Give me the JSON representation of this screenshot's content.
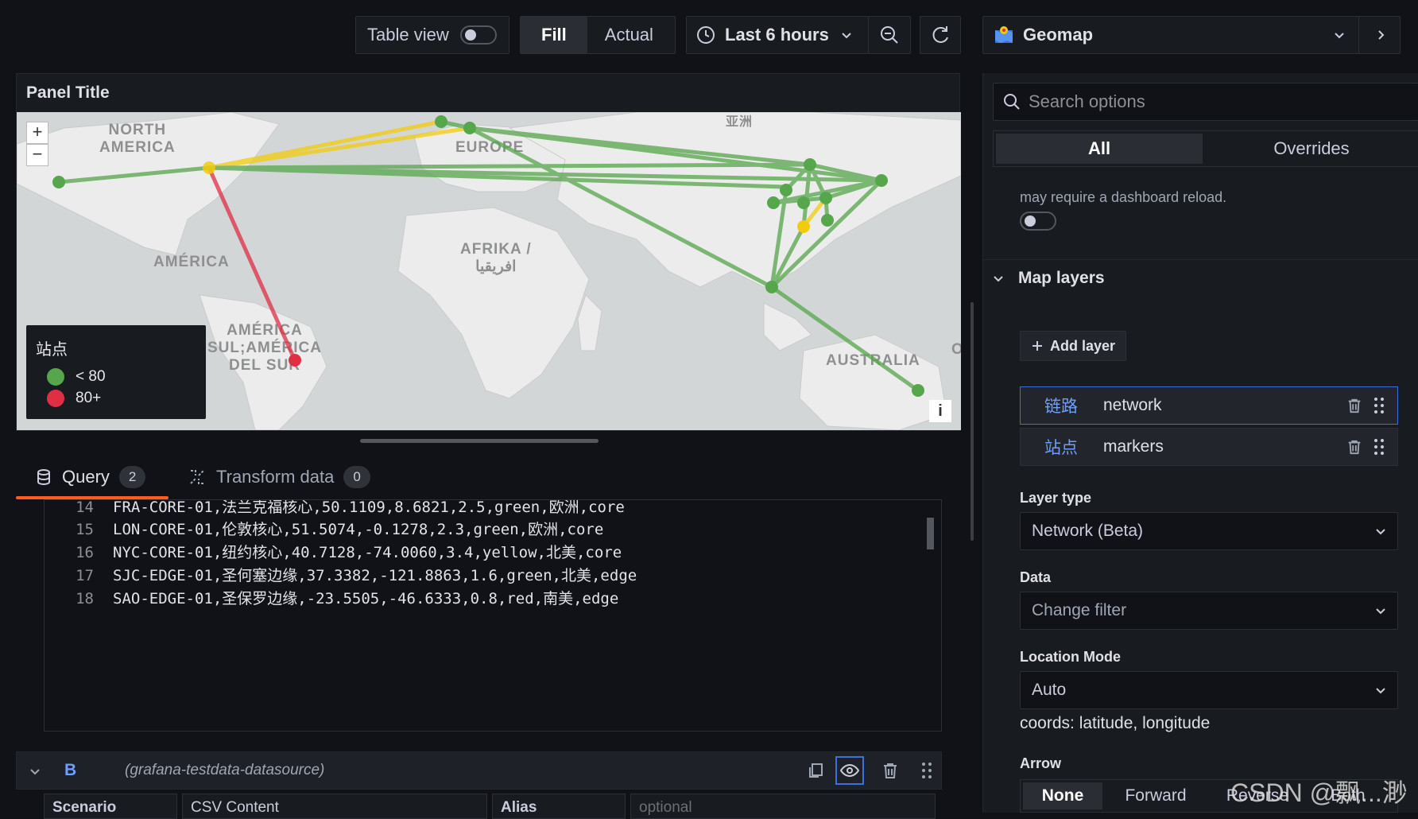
{
  "toolbar": {
    "table_view_label": "Table view",
    "fill_label": "Fill",
    "actual_label": "Actual",
    "time_range": "Last 6 hours",
    "visualization": "Geomap"
  },
  "panel": {
    "title": "Panel Title",
    "map_labels": {
      "north_america": "NORTH\nAMERICA",
      "europe": "EUROPE",
      "asia": "亚洲",
      "america": "AMÉRICA",
      "africa": "AFRIKA /\nافريقيا",
      "south_america": "AMÉRICA\nSUL;AMÉRICA\nDEL SUR",
      "australia": "AUSTRALIA",
      "edge_char": "O"
    },
    "legend": {
      "title": "站点",
      "items": [
        {
          "label": "< 80",
          "color": "#56a64b"
        },
        {
          "label": "80+",
          "color": "#e02f44"
        }
      ]
    },
    "info_label": "i"
  },
  "query_tabs": {
    "query_label": "Query",
    "query_count": "2",
    "transform_label": "Transform data",
    "transform_count": "0"
  },
  "editor": {
    "lines": [
      {
        "num": "14",
        "text": "FRA-CORE-01,法兰克福核心,50.1109,8.6821,2.5,green,欧洲,core"
      },
      {
        "num": "15",
        "text": "LON-CORE-01,伦敦核心,51.5074,-0.1278,2.3,green,欧洲,core"
      },
      {
        "num": "16",
        "text": "NYC-CORE-01,纽约核心,40.7128,-74.0060,3.4,yellow,北美,core"
      },
      {
        "num": "17",
        "text": "SJC-EDGE-01,圣何塞边缘,37.3382,-121.8863,1.6,green,北美,edge"
      },
      {
        "num": "18",
        "text": "SAO-EDGE-01,圣保罗边缘,-23.5505,-46.6333,0.8,red,南美,edge"
      }
    ]
  },
  "query_b": {
    "letter": "B",
    "datasource": "(grafana-testdata-datasource)",
    "scenario_label": "Scenario",
    "scenario_value": "CSV Content",
    "alias_label": "Alias",
    "alias_placeholder": "optional"
  },
  "options": {
    "search_placeholder": "Search options",
    "tab_all": "All",
    "tab_overrides": "Overrides",
    "reload_note": "may require a dashboard reload.",
    "map_layers_title": "Map layers",
    "add_layer_label": "Add layer",
    "layers": [
      {
        "name": "链路",
        "type": "network"
      },
      {
        "name": "站点",
        "type": "markers"
      }
    ],
    "layer_type_label": "Layer type",
    "layer_type_value": "Network (Beta)",
    "data_label": "Data",
    "data_value": "Change filter",
    "location_mode_label": "Location Mode",
    "location_mode_value": "Auto",
    "coords_note": "coords: latitude, longitude",
    "arrow_label": "Arrow",
    "arrow_options": [
      "None",
      "Forward",
      "Reverse",
      "Both"
    ]
  },
  "watermark": "CSDN @飘...渺",
  "colors": {
    "green": "#56a64b",
    "yellow": "#f2cc0c",
    "red": "#e02f44",
    "accent_orange": "#ff5a1f",
    "accent_blue": "#6e9fff"
  }
}
